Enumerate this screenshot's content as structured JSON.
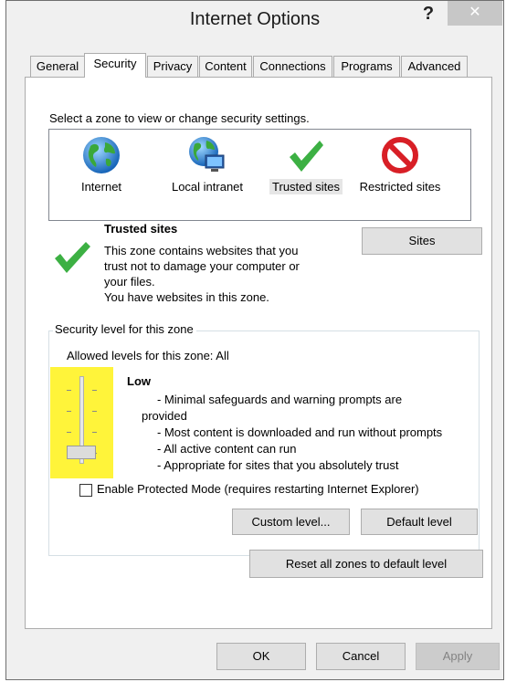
{
  "window": {
    "title": "Internet Options",
    "help_glyph": "?",
    "close_glyph": "✕"
  },
  "tabs": [
    {
      "label": "General"
    },
    {
      "label": "Security",
      "active": true
    },
    {
      "label": "Privacy"
    },
    {
      "label": "Content"
    },
    {
      "label": "Connections"
    },
    {
      "label": "Programs"
    },
    {
      "label": "Advanced"
    }
  ],
  "security": {
    "zone_prompt": "Select a zone to view or change security settings.",
    "zones": [
      {
        "label": "Internet",
        "icon": "globe-icon"
      },
      {
        "label": "Local intranet",
        "icon": "intranet-icon"
      },
      {
        "label": "Trusted sites",
        "icon": "checkmark-icon",
        "selected": true
      },
      {
        "label": "Restricted sites",
        "icon": "prohibited-icon"
      }
    ],
    "selected_zone": {
      "title": "Trusted sites",
      "description_lines": [
        "This zone contains websites that you",
        "trust not to damage your computer or",
        "your files.",
        "You have websites in this zone."
      ],
      "sites_button": "Sites"
    },
    "level_group_label": "Security level for this zone",
    "allowed_levels": "Allowed levels for this zone: All",
    "slider": {
      "level": 0,
      "levels_count": 5
    },
    "level": {
      "name": "Low",
      "description_lines": [
        "- Minimal safeguards and warning prompts are",
        "provided",
        "- Most content is downloaded and run without prompts",
        "- All active content can run",
        "- Appropriate for sites that you absolutely trust"
      ]
    },
    "protected_mode": {
      "label": "Enable Protected Mode (requires restarting Internet Explorer)",
      "checked": false
    },
    "custom_level_button": "Custom level...",
    "default_level_button": "Default level",
    "reset_all_button": "Reset all zones to default level"
  },
  "footer": {
    "ok": "OK",
    "cancel": "Cancel",
    "apply": "Apply"
  },
  "colors": {
    "highlight": "#fff43a",
    "check_green": "#3cb043",
    "prohibited_red": "#d81f26",
    "close_button_bg": "#c7c7c7"
  }
}
